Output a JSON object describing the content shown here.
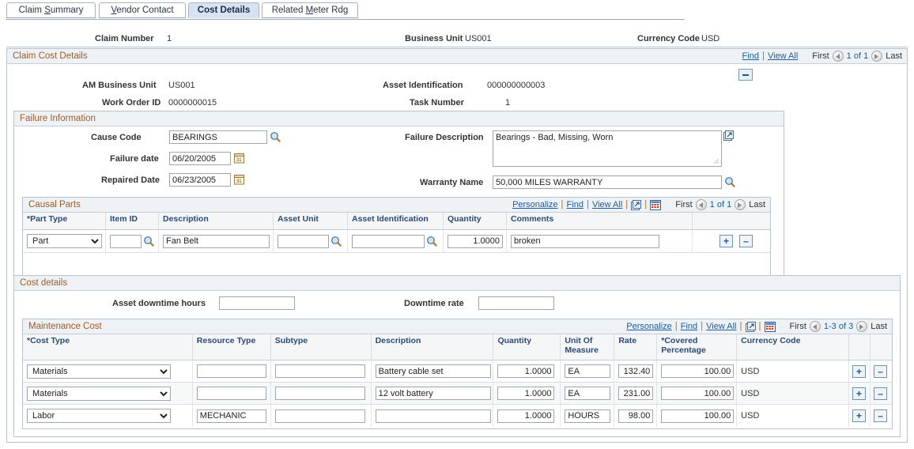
{
  "tabs": [
    {
      "label_pre": "Claim ",
      "accel": "S",
      "label_post": "ummary",
      "active": false
    },
    {
      "label_pre": "",
      "accel": "V",
      "label_post": "endor Contact",
      "active": false
    },
    {
      "label_pre": "Cost Details",
      "accel": "",
      "label_post": "",
      "active": true
    },
    {
      "label_pre": "Related ",
      "accel": "M",
      "label_post": "eter Rdg",
      "active": false
    }
  ],
  "header": {
    "claim_number_label": "Claim Number",
    "claim_number_value": "1",
    "business_unit_label": "Business Unit",
    "business_unit_value": "US001",
    "currency_code_label": "Currency Code",
    "currency_code_value": "USD"
  },
  "claim_cost_details": {
    "title": "Claim Cost Details",
    "find": "Find",
    "view_all": "View All",
    "first": "First",
    "counter": "1 of 1",
    "last": "Last",
    "am_business_unit_label": "AM Business Unit",
    "am_business_unit_value": "US001",
    "asset_identification_label": "Asset Identification",
    "asset_identification_value": "000000000003",
    "work_order_id_label": "Work Order ID",
    "work_order_id_value": "0000000015",
    "task_number_label": "Task Number",
    "task_number_value": "1"
  },
  "failure_information": {
    "title": "Failure Information",
    "cause_code_label": "Cause Code",
    "cause_code_value": "BEARINGS",
    "failure_date_label": "Failure date",
    "failure_date_value": "06/20/2005",
    "repaired_date_label": "Repaired Date",
    "repaired_date_value": "06/23/2005",
    "failure_description_label": "Failure Description",
    "failure_description_value": "Bearings - Bad, Missing, Worn",
    "warranty_name_label": "Warranty Name",
    "warranty_name_value": "50,000 MILES WARRANTY"
  },
  "causal_parts": {
    "title": "Causal Parts",
    "personalize": "Personalize",
    "find": "Find",
    "view_all": "View All",
    "first": "First",
    "counter": "1 of 1",
    "last": "Last",
    "columns": [
      "*Part Type",
      "Item ID",
      "Description",
      "Asset Unit",
      "Asset Identification",
      "Quantity",
      "Comments",
      ""
    ],
    "rows": [
      {
        "part_type": "Part",
        "item_id": "",
        "description": "Fan Belt",
        "asset_unit": "",
        "asset_identification": "",
        "quantity": "1.0000",
        "comments": "broken",
        "add": "+",
        "remove": "–"
      }
    ],
    "part_type_options": [
      "Part"
    ]
  },
  "cost_details": {
    "title": "Cost details",
    "asset_downtime_hours_label": "Asset downtime hours",
    "asset_downtime_hours_value": "",
    "downtime_rate_label": "Downtime rate",
    "downtime_rate_value": ""
  },
  "maintenance_cost": {
    "title": "Maintenance Cost",
    "personalize": "Personalize",
    "find": "Find",
    "view_all": "View All",
    "first": "First",
    "counter": "1-3 of 3",
    "last": "Last",
    "columns": [
      "*Cost Type",
      "Resource Type",
      "Subtype",
      "Description",
      "Quantity",
      "Unit Of Measure",
      "Rate",
      "*Covered Percentage",
      "Currency Code",
      "",
      ""
    ],
    "cost_type_options": [
      "Materials",
      "Labor"
    ],
    "rows": [
      {
        "cost_type": "Materials",
        "resource_type": "",
        "subtype": "",
        "description": "Battery cable set",
        "quantity": "1.0000",
        "uom": "EA",
        "rate": "132.40",
        "covered_percentage": "100.00",
        "currency_code": "USD",
        "add": "+",
        "remove": "–"
      },
      {
        "cost_type": "Materials",
        "resource_type": "",
        "subtype": "",
        "description": "12 volt battery",
        "quantity": "1.0000",
        "uom": "EA",
        "rate": "231.00",
        "covered_percentage": "100.00",
        "currency_code": "USD",
        "add": "+",
        "remove": "–"
      },
      {
        "cost_type": "Labor",
        "resource_type": "MECHANIC",
        "subtype": "",
        "description": "",
        "quantity": "1.0000",
        "uom": "HOURS",
        "rate": "98.00",
        "covered_percentage": "100.00",
        "currency_code": "USD",
        "add": "+",
        "remove": "–"
      }
    ]
  },
  "colors": {
    "link": "#1b5ba3",
    "band_title": "#9e5b2a",
    "column_header": "#2c4a73",
    "tab_active": "#d7e3f1"
  }
}
